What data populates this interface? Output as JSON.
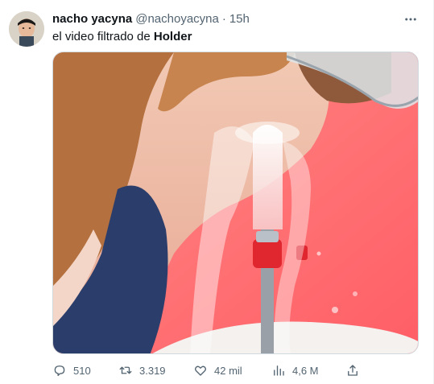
{
  "author": {
    "name": "nacho yacyna",
    "handle": "@nachoyacyna",
    "separator": "·",
    "time": "15h"
  },
  "tweet": {
    "text_prefix": "el video filtrado de ",
    "text_bold": "Holder"
  },
  "actions": {
    "reply": "510",
    "retweet": "3.319",
    "like": "42 mil",
    "views": "4,6 M"
  },
  "colors": {
    "text": "#0f1419",
    "secondary": "#536471",
    "border": "#cfd9de",
    "media_background": "#ff6f70"
  },
  "icons": [
    "more-icon",
    "reply-icon",
    "retweet-icon",
    "like-icon",
    "views-icon",
    "share-icon"
  ]
}
